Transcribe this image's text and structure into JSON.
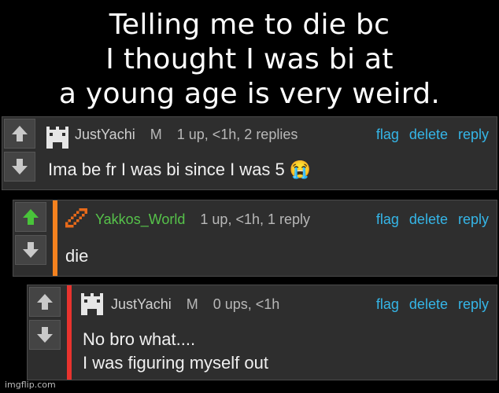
{
  "caption": {
    "line1": "Telling me to die bc",
    "line2": "I thought I was bi at",
    "line3": "a young age is very weird."
  },
  "comments": [
    {
      "username": "JustYachi",
      "mod_badge": "M",
      "stats": "1 up, <1h, 2 replies",
      "text_lines": [
        "Ima be fr I was bi since I was 5 😭"
      ],
      "upvoted": false,
      "bar_color": ""
    },
    {
      "username": "Yakkos_World",
      "mod_badge": "",
      "stats": "1 up, <1h, 1 reply",
      "text_lines": [
        "die"
      ],
      "upvoted": true,
      "bar_color": "#f5821f"
    },
    {
      "username": "JustYachi",
      "mod_badge": "M",
      "stats": "0 ups, <1h",
      "text_lines": [
        "No bro what....",
        "I was figuring myself out"
      ],
      "upvoted": false,
      "bar_color": "#e8332e"
    }
  ],
  "actions": {
    "flag": "flag",
    "delete": "delete",
    "reply": "reply"
  },
  "colors": {
    "link": "#35b6e8",
    "upvote_active": "#49c43a",
    "nested_orange": "#f5821f",
    "nested_red": "#e8332e"
  },
  "watermark": "imgflip.com"
}
